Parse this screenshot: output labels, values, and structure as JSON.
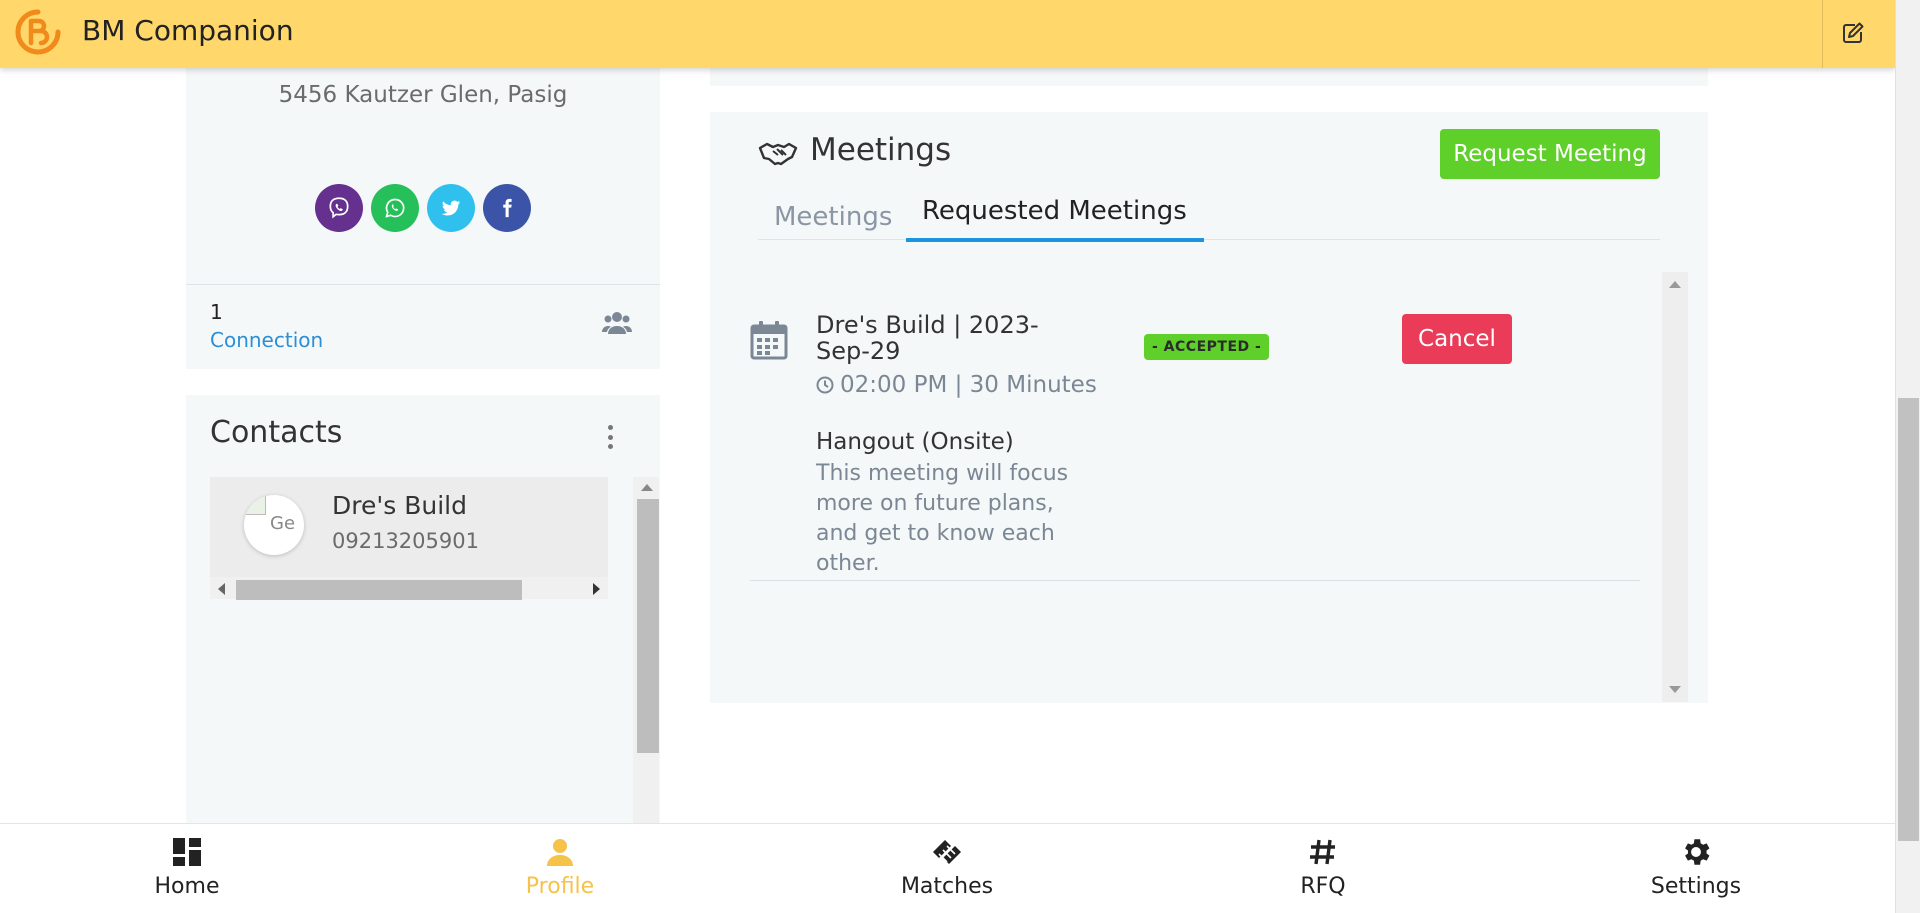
{
  "app": {
    "title": "BM Companion"
  },
  "profile": {
    "address": "5456 Kautzer Glen, Pasig",
    "social": [
      "viber-icon",
      "whatsapp-icon",
      "twitter-icon",
      "facebook-icon"
    ],
    "connections": {
      "count": "1",
      "label": "Connection"
    }
  },
  "contacts": {
    "title": "Contacts",
    "items": [
      {
        "name": "Dre's Build",
        "phone": "09213205901",
        "avatar_alt": "Ge"
      }
    ]
  },
  "meetings": {
    "title": "Meetings",
    "request_button": "Request Meeting",
    "tabs": [
      {
        "label": "Meetings",
        "active": false
      },
      {
        "label": "Requested Meetings",
        "active": true
      }
    ],
    "items": [
      {
        "title": "Dre's Build | 2023-Sep-29",
        "time": "02:00 PM | 30 Minutes",
        "status": "- ACCEPTED -",
        "cancel_label": "Cancel",
        "type": "Hangout (Onsite)",
        "description": "This meeting will focus more on future plans, and get to know each other."
      }
    ]
  },
  "nav": [
    {
      "label": "Home",
      "icon": "dashboard-icon",
      "active": false
    },
    {
      "label": "Profile",
      "icon": "person-icon",
      "active": true
    },
    {
      "label": "Matches",
      "icon": "handshake-icon",
      "active": false
    },
    {
      "label": "RFQ",
      "icon": "hashtag-icon",
      "active": false
    },
    {
      "label": "Settings",
      "icon": "gear-icon",
      "active": false
    }
  ],
  "colors": {
    "header_bg": "#ffd76a",
    "accent_green": "#5fcf2a",
    "cancel_red": "#ea3b58",
    "tab_underline": "#1d94e0",
    "nav_active": "#f5c24a",
    "viber": "#66308e",
    "whatsapp": "#25c05a",
    "twitter": "#2fc0ee",
    "facebook": "#3c54a8"
  }
}
